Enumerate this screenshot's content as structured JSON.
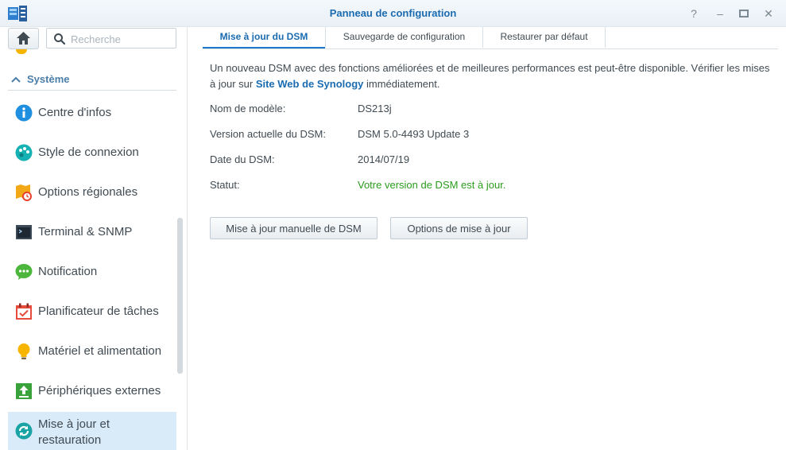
{
  "window": {
    "title": "Panneau de configuration",
    "controls": {
      "help": "?",
      "minimize": "–",
      "maximize": "▭",
      "close": "✕"
    }
  },
  "sidebar": {
    "search_placeholder": "Recherche",
    "section_label": "Système",
    "items": [
      {
        "label": "Centre d'infos",
        "icon": "info-icon"
      },
      {
        "label": "Style de connexion",
        "icon": "palette-icon"
      },
      {
        "label": "Options régionales",
        "icon": "map-clock-icon"
      },
      {
        "label": "Terminal & SNMP",
        "icon": "terminal-icon"
      },
      {
        "label": "Notification",
        "icon": "chat-bubble-icon"
      },
      {
        "label": "Planificateur de tâches",
        "icon": "calendar-check-icon"
      },
      {
        "label": "Matériel et alimentation",
        "icon": "lightbulb-icon"
      },
      {
        "label": "Périphériques externes",
        "icon": "upload-box-icon"
      },
      {
        "label": "Mise à jour et restauration",
        "icon": "refresh-icon",
        "selected": true
      }
    ]
  },
  "tabs": [
    {
      "label": "Mise à jour du DSM",
      "active": true
    },
    {
      "label": "Sauvegarde de configuration"
    },
    {
      "label": "Restaurer par défaut"
    }
  ],
  "main": {
    "intro_before": "Un nouveau DSM avec des fonctions améliorées et de meilleures performances est peut-être disponible. Vérifier les mises à jour sur ",
    "intro_link": "Site Web de Synology",
    "intro_after": " immédiatement.",
    "fields": [
      {
        "label": "Nom de modèle:",
        "value": "DS213j"
      },
      {
        "label": "Version actuelle du DSM:",
        "value": "DSM 5.0-4493 Update 3"
      },
      {
        "label": "Date du DSM:",
        "value": "2014/07/19"
      },
      {
        "label": "Statut:",
        "value": "Votre version de DSM est à jour."
      }
    ],
    "buttons": {
      "manual_update": "Mise à jour manuelle de DSM",
      "update_options": "Options de mise à jour"
    }
  },
  "colors": {
    "accent": "#1a6bb0",
    "status_ok": "#2a9d1c",
    "selected_bg": "#d9ebf9"
  }
}
